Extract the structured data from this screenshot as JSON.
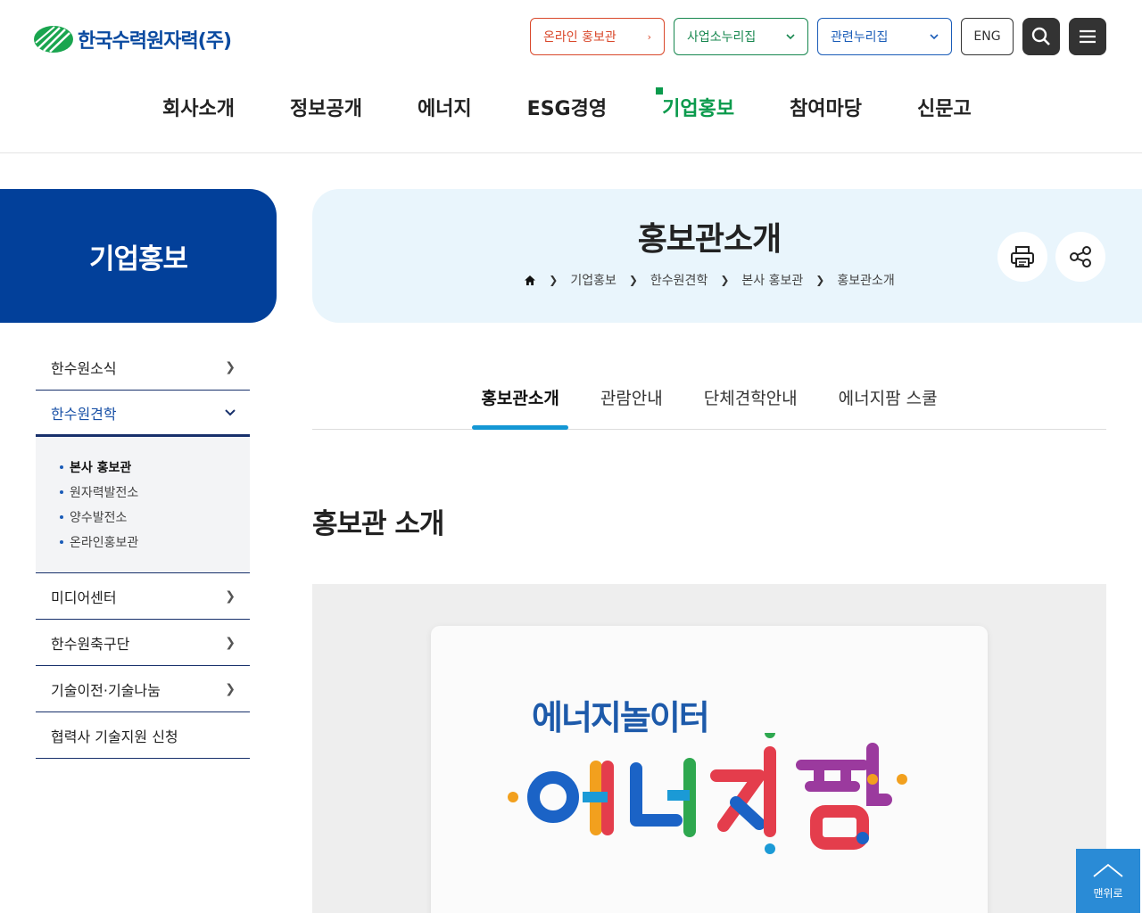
{
  "header": {
    "logo_text": "한국수력원자력(주)",
    "util": {
      "online_label": "온라인 홍보관",
      "biz_label": "사업소누리집",
      "related_label": "관련누리집",
      "eng_label": "ENG"
    },
    "gnb": [
      {
        "label": "회사소개"
      },
      {
        "label": "정보공개"
      },
      {
        "label": "에너지"
      },
      {
        "label": "ESG경영"
      },
      {
        "label": "기업홍보",
        "active": true
      },
      {
        "label": "참여마당"
      },
      {
        "label": "신문고"
      }
    ]
  },
  "sidebar": {
    "title": "기업홍보",
    "items": [
      {
        "label": "한수원소식"
      },
      {
        "label": "한수원견학",
        "open": true
      },
      {
        "label": "미디어센터"
      },
      {
        "label": "한수원축구단"
      },
      {
        "label": "기술이전·기술나눔"
      },
      {
        "label": "협력사 기술지원 신청"
      }
    ],
    "sub_items": [
      {
        "label": "본사 홍보관",
        "current": true
      },
      {
        "label": "원자력발전소"
      },
      {
        "label": "양수발전소"
      },
      {
        "label": "온라인홍보관"
      }
    ]
  },
  "page": {
    "title": "홍보관소개",
    "breadcrumb": [
      "기업홍보",
      "한수원견학",
      "본사 홍보관",
      "홍보관소개"
    ],
    "tabs": [
      {
        "label": "홍보관소개",
        "active": true
      },
      {
        "label": "관람안내"
      },
      {
        "label": "단체견학안내"
      },
      {
        "label": "에너지팜 스쿨"
      }
    ],
    "section_title": "홍보관 소개",
    "hero": {
      "subtitle": "에너지놀이터"
    }
  },
  "top_button_label": "맨위로",
  "icons": [
    "logo-icon",
    "chevron-right-icon",
    "chevron-down-icon",
    "search-icon",
    "menu-icon",
    "home-icon",
    "print-icon",
    "share-icon",
    "arrow-up-icon"
  ],
  "colors": {
    "primary_blue": "#02409a",
    "accent_green": "#0a9a4c",
    "online_red": "#d9482b",
    "tab_underline": "#1497d4",
    "title_panel_bg": "#e9f5fc"
  }
}
